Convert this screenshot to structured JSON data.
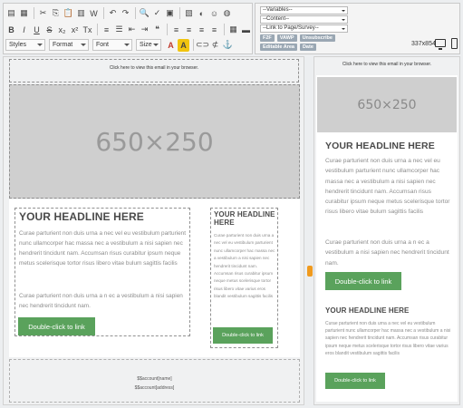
{
  "toolbar": {
    "row1": [
      {
        "name": "source-icon",
        "glyph": "▤"
      },
      {
        "name": "template-icon",
        "glyph": "▦"
      },
      {
        "name": "cut-icon",
        "glyph": "✂"
      },
      {
        "name": "copy-icon",
        "glyph": "⎘"
      },
      {
        "name": "paste-icon",
        "glyph": "📋"
      },
      {
        "name": "paste-text-icon",
        "glyph": "▥"
      },
      {
        "name": "paste-word-icon",
        "glyph": "W"
      },
      {
        "name": "undo-icon",
        "glyph": "↶"
      },
      {
        "name": "redo-icon",
        "glyph": "↷"
      },
      {
        "name": "find-icon",
        "glyph": "🔍"
      },
      {
        "name": "spellcheck-icon",
        "glyph": "✓"
      },
      {
        "name": "select-all-icon",
        "glyph": "▣"
      },
      {
        "name": "image-icon",
        "glyph": "▧"
      },
      {
        "name": "flash-icon",
        "glyph": "◐"
      },
      {
        "name": "smiley-icon",
        "glyph": "☺"
      },
      {
        "name": "special-char-icon",
        "glyph": "◍"
      }
    ],
    "row2": [
      {
        "name": "bold-icon",
        "glyph": "B",
        "cls": "bold"
      },
      {
        "name": "italic-icon",
        "glyph": "I",
        "cls": "ital"
      },
      {
        "name": "underline-icon",
        "glyph": "U",
        "cls": "und"
      },
      {
        "name": "strike-icon",
        "glyph": "S",
        "cls": "strk"
      },
      {
        "name": "subscript-icon",
        "glyph": "x₂"
      },
      {
        "name": "superscript-icon",
        "glyph": "x²"
      },
      {
        "name": "remove-format-icon",
        "glyph": "Tx"
      },
      {
        "name": "numbered-list-icon",
        "glyph": "≡"
      },
      {
        "name": "bulleted-list-icon",
        "glyph": "☰"
      },
      {
        "name": "outdent-icon",
        "glyph": "⇤"
      },
      {
        "name": "indent-icon",
        "glyph": "⇥"
      },
      {
        "name": "blockquote-icon",
        "glyph": "❝"
      },
      {
        "name": "align-left-icon",
        "glyph": "≡"
      },
      {
        "name": "align-center-icon",
        "glyph": "≡"
      },
      {
        "name": "align-right-icon",
        "glyph": "≡"
      },
      {
        "name": "justify-icon",
        "glyph": "≡"
      },
      {
        "name": "table-icon",
        "glyph": "▦"
      },
      {
        "name": "hr-icon",
        "glyph": "▬"
      },
      {
        "name": "omega-icon",
        "glyph": "Ω"
      }
    ],
    "styles_label": "Styles",
    "format_label": "Format",
    "font_label": "Font",
    "size_label": "Size",
    "row3_icons": [
      {
        "name": "text-color-icon",
        "glyph": "A"
      },
      {
        "name": "bg-color-icon",
        "glyph": "A"
      },
      {
        "name": "link-icon",
        "glyph": "⊂⊃"
      },
      {
        "name": "unlink-icon",
        "glyph": "⊄"
      },
      {
        "name": "anchor-icon",
        "glyph": "⚓"
      }
    ]
  },
  "merge": {
    "variables": "--Variables--",
    "content": "--Content--",
    "link_to_page": "--Link to Page/Survey--",
    "tags": [
      "F2F",
      "VAWP",
      "Unsubscribe",
      "Editable Area",
      "Date"
    ],
    "dimensions": "337x854"
  },
  "desktop": {
    "view_in_browser": "Click here to view this email in your browser.",
    "hero_placeholder": "650×250",
    "left_col": {
      "headline": "YOUR HEADLINE HERE",
      "para1": "Curae parturient non duis urna a nec vel eu vestibulum parturient nunc ullamcorper hac massa nec a vestibulum a nisi sapien nec hendrerit tincidunt nam. Accumsan risus curabitur ipsum neque metus scelerisque tortor risus libero vitae bulum sagittis facilis",
      "para2": "Curae parturient non duis urna a n ec a vestibulum a nisi sapien nec hendrerit tincidunt nam.",
      "button": "Double-click to link"
    },
    "right_col": {
      "headline": "YOUR HEADLINE HERE",
      "para": "Curae parturient non duis urna a nec vel eu vestibulum parturient nunc ullamcorper hac massa nec a vestibulum a nisi sapien nec hendrerit tincidunt nam. Accumsan risus curabitur ipsum neque metus scelerisque tortor risus libero vitae varius eros blandit vestibulum sagittis facilis",
      "button": "Double-click to link"
    },
    "footer_name": "$$account[name]",
    "footer_address": "$$account[address]"
  },
  "mobile": {
    "view_in_browser": "Click here to view this email in your browser.",
    "placeholder": "650×250",
    "headline1": "YOUR HEADLINE HERE",
    "para1": "Curae parturient non duis urna a nec vel eu vestibulum parturient nunc ullamcorper hac massa nec a vestibulum a nisi sapien nec hendrerit tincidunt nam. Accumsan risus curabitur ipsum neque metus scelerisque tortor risus libero vitae bulum sagittis facilis",
    "para2": "Curae parturient non duis urna a n ec a vestibulum a nisi sapien nec hendrerit tincidunt nam.",
    "button1": "Double-click to link",
    "headline2": "YOUR HEADLINE HERE",
    "para3": "Curae parturient non duis urna a nec vel eu vestibulum parturient nunc ullamcorper hac massa nec a vestibulum a nisi sapien nec hendrerit tincidunt nam. Accumsan risus curabitur ipsum neque metus scelerisque tortor risus libero vitae varius eros blandit vestibulum sagittis facilis",
    "button2": "Double-click to link"
  },
  "colors": {
    "button_green": "#5aa25c",
    "tag_gray": "#9aa7b3",
    "splitter_orange": "#f09a1e",
    "placeholder_gray": "#cfcfcf"
  }
}
